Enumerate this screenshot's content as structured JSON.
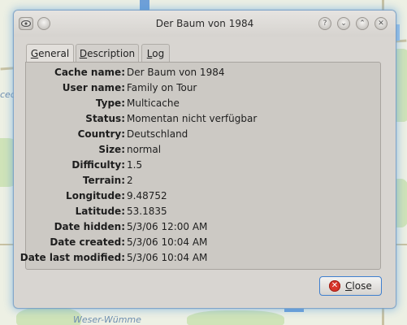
{
  "window": {
    "title": "Der Baum von 1984"
  },
  "tabs": [
    {
      "label": "General",
      "accel": "G",
      "rest": "eneral",
      "active": true
    },
    {
      "label": "Description",
      "accel": "D",
      "rest": "escription",
      "active": false
    },
    {
      "label": "Log",
      "accel": "L",
      "rest": "og",
      "active": false
    }
  ],
  "details": [
    {
      "label": "Cache name:",
      "value": "Der Baum von 1984"
    },
    {
      "label": "User name:",
      "value": "Family on Tour"
    },
    {
      "label": "Type:",
      "value": "Multicache"
    },
    {
      "label": "Status:",
      "value": "Momentan nicht verfügbar"
    },
    {
      "label": "Country:",
      "value": "Deutschland"
    },
    {
      "label": "Size:",
      "value": "normal"
    },
    {
      "label": "Difficulty:",
      "value": "1.5"
    },
    {
      "label": "Terrain:",
      "value": "2"
    },
    {
      "label": "Longitude:",
      "value": "9.48752"
    },
    {
      "label": "Latitude:",
      "value": "53.1835"
    },
    {
      "label": "Date hidden:",
      "value": "5/3/06 12:00 AM"
    },
    {
      "label": "Date created:",
      "value": "5/3/06 10:04 AM"
    },
    {
      "label": "Date last modified:",
      "value": "5/3/06 10:04 AM"
    }
  ],
  "close_button": {
    "label": "Close",
    "accel": "C",
    "rest": "lose"
  },
  "map": {
    "labels": [
      "ced",
      "Weser-Wümme"
    ]
  }
}
